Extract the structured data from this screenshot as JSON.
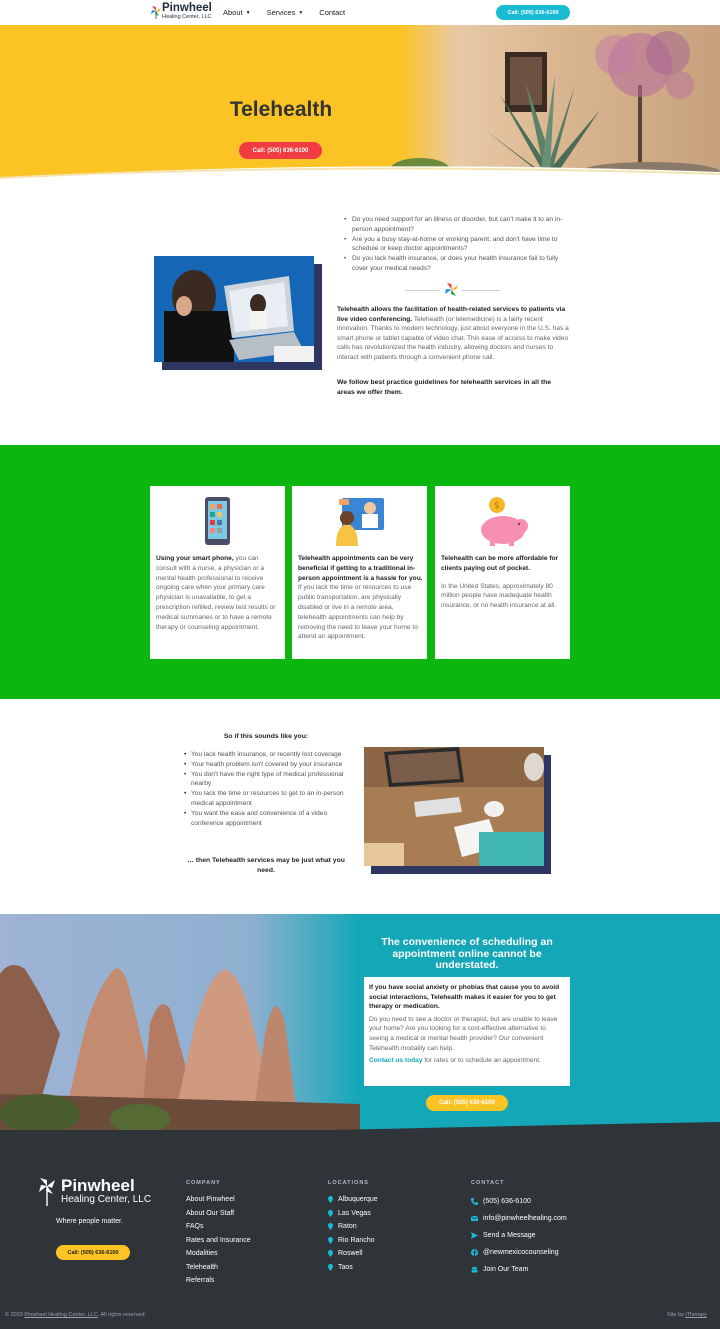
{
  "header": {
    "logo_line1": "Pinwheel",
    "logo_line2": "Healing Center, LLC",
    "nav": [
      {
        "label": "About",
        "has_dropdown": true
      },
      {
        "label": "Services",
        "has_dropdown": true
      },
      {
        "label": "Contact",
        "has_dropdown": false
      }
    ],
    "call_button": "Call: (505) 636-6100"
  },
  "hero": {
    "title": "Telehealth",
    "call_button": "Call: (505) 636-6100"
  },
  "intro": {
    "bullets": [
      "Do you need support for an illness or disorder, but can't make it to an in-person appointment?",
      "Are you a busy stay-at-home or working parent, and don't have time to schedule or keep doctor appointments?",
      "Do you lack health insurance, or does your health insurance fail to fully cover your medical needs?"
    ],
    "para_bold": "Telehealth allows the facilitation of health-related services to patients via live video conferencing.",
    "para_rest": " Telehealth (or telemedicine) is a fairly recent innovation. Thanks to modern technology, just about everyone in the U.S. has a smart phone or tablet capable of video chat. This ease of access to make video calls has revolutionized the health industry, allowing doctors and nurses to interact with patients through a convenient phone call.",
    "para2": "We follow best practice guidelines for telehealth services in all the areas we offer them."
  },
  "cards": [
    {
      "icon": "smartphone-icon",
      "bold": "Using your smart phone,",
      "text": " you can consult with a nurse, a physician or a mental health professional to receive ongoing care when your primary care physician is unavailable, to get a prescription refilled, review test results or medical summaries or to have a remote therapy or counseling appointment.",
      "text2": ""
    },
    {
      "icon": "video-consult-icon",
      "bold": "Telehealth appointments can be very beneficial if getting to a traditional in-person appointment is a hassle for you.",
      "text": " If you lack the time or resources to use public transportation, are physically disabled or live in a remote area, telehealth appointments can help by removing the need to leave your home to attend an appointment.",
      "text2": ""
    },
    {
      "icon": "piggy-bank-icon",
      "bold": "Telehealth can be more affordable for clients paying out of pocket.",
      "text": "",
      "text2": "In the United States, approximately 80 million people have inadequate health insurance, or no health insurance at all."
    }
  ],
  "sounds_like": {
    "title": "So if this sounds like you:",
    "items": [
      "You lack health insurance, or recently lost coverage",
      "Your health problem isn't covered by your insurance",
      "You don't have the right type of medical professional nearby",
      "You lack the time or resources to get to an in-person medical appointment",
      "You want the ease and convenience of a video conference appointment"
    ],
    "closing": "… then Telehealth services may be just what you need."
  },
  "convenience": {
    "heading": "The convenience of scheduling an appointment online cannot be understated.",
    "bold": "If you have social anxiety or phobias that cause you to avoid social interactions, Telehealth makes it easier for you to get therapy or medication.",
    "text": "Do you need to see a doctor or therapist, but are unable to leave your home? Are you looking for a cost-effective alternative to seeing a medical or mental health provider? Our convenient Telehealth modality can help.",
    "link": "Contact us today",
    "link_rest": " for rates or to schedule an appointment.",
    "call_button": "Call: (505) 636-6100"
  },
  "footer": {
    "logo_line1": "Pinwheel",
    "logo_line2": "Healing Center, LLC",
    "tagline": "Where people matter.",
    "call_button": "Call: (505) 636-6100",
    "company": {
      "heading": "COMPANY",
      "links": [
        "About Pinwheel",
        "About Our Staff",
        "FAQs",
        "Rates and Insurance",
        "Modalities",
        "Telehealth",
        "Referrals"
      ]
    },
    "locations": {
      "heading": "LOCATIONS",
      "links": [
        "Albuquerque",
        "Las Vegas",
        "Raton",
        "Rio Rancho",
        "Roswell",
        "Taos"
      ]
    },
    "contact": {
      "heading": "CONTACT",
      "items": [
        {
          "icon": "phone-icon",
          "label": "(505) 636-6100"
        },
        {
          "icon": "email-icon",
          "label": "info@pinwheelhealing.com"
        },
        {
          "icon": "message-icon",
          "label": "Send a Message"
        },
        {
          "icon": "facebook-icon",
          "label": "@newmexicocounseling"
        },
        {
          "icon": "team-icon",
          "label": "Join Our Team"
        }
      ]
    },
    "copyright_prefix": "© 2023 ",
    "copyright_link": "Pinwheel Healing Center, LLC",
    "copyright_suffix": ". All rights reserved.",
    "site_by_prefix": "Site by ",
    "site_by_link": "iTherapy"
  },
  "colors": {
    "yellow": "#fbc424",
    "cyan": "#19bcd2",
    "red": "#ef3d42",
    "green": "#0bb60f",
    "teal": "#13a7b8",
    "navy": "#2d3561",
    "footer": "#2f3439"
  }
}
